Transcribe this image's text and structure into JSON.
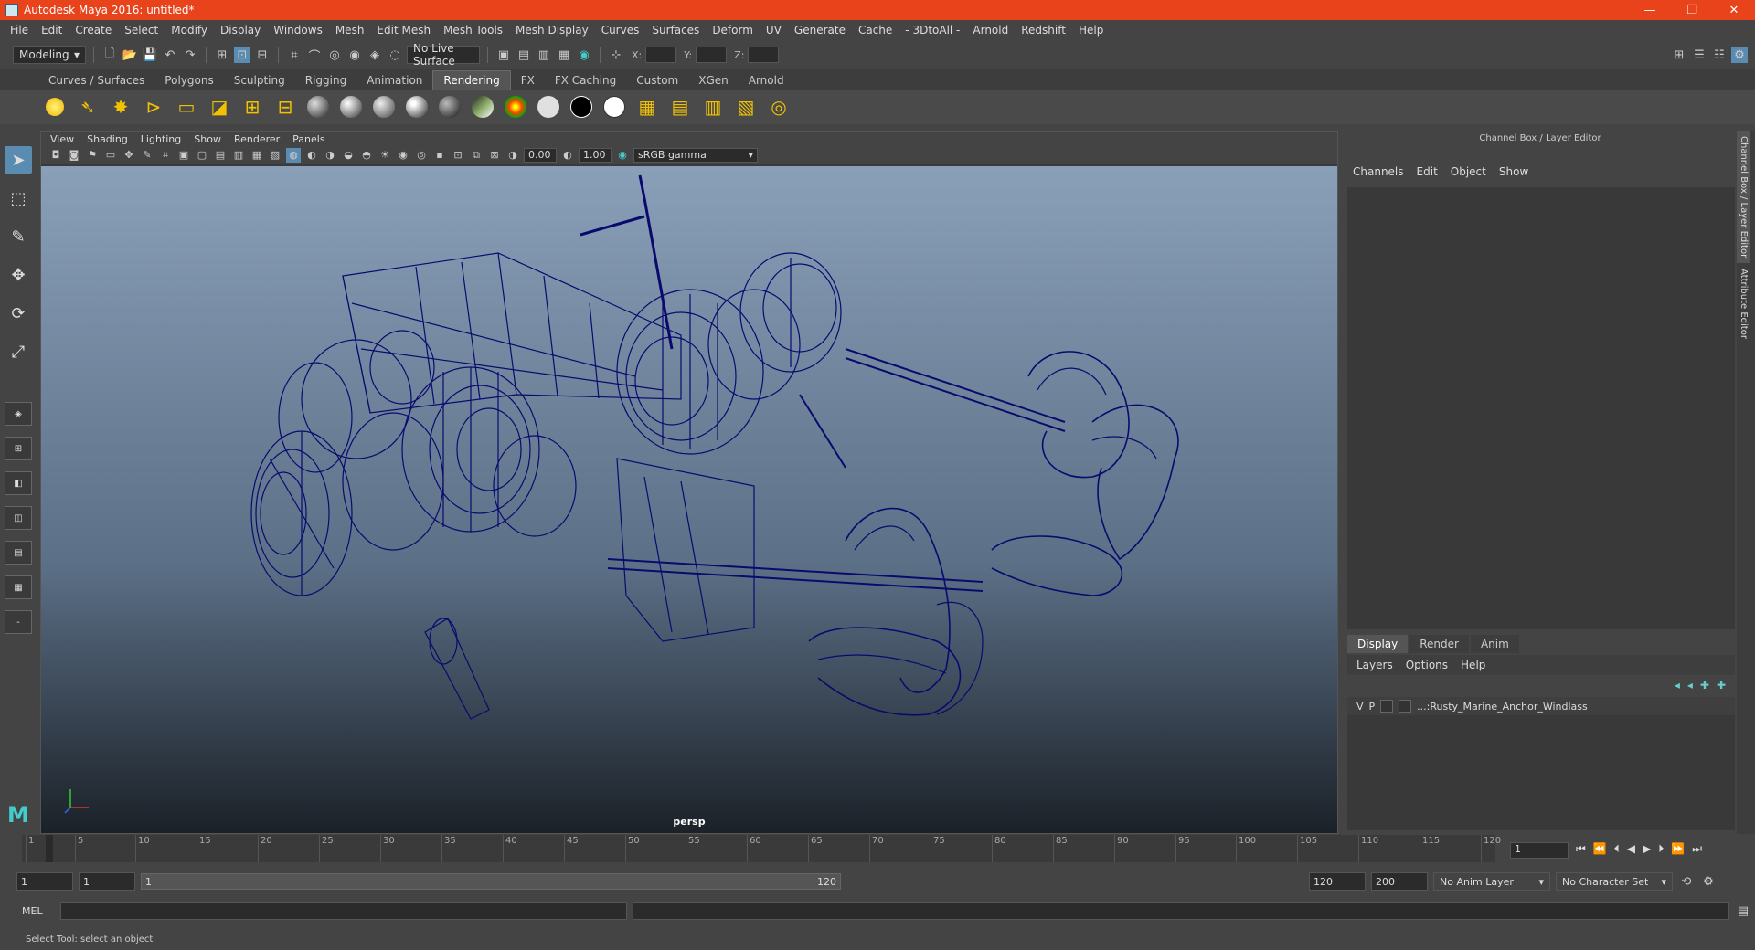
{
  "window": {
    "title": "Autodesk Maya 2016: untitled*",
    "controls": [
      "—",
      "❐",
      "✕"
    ]
  },
  "menubar": [
    "File",
    "Edit",
    "Create",
    "Select",
    "Modify",
    "Display",
    "Windows",
    "Mesh",
    "Edit Mesh",
    "Mesh Tools",
    "Mesh Display",
    "Curves",
    "Surfaces",
    "Deform",
    "UV",
    "Generate",
    "Cache",
    "- 3DtoAll -",
    "Arnold",
    "Redshift",
    "Help"
  ],
  "statusline": {
    "mode": "Modeling",
    "live_surface": "No Live Surface",
    "x_label": "X:",
    "y_label": "Y:",
    "z_label": "Z:"
  },
  "shelf": {
    "tabs": [
      "Curves / Surfaces",
      "Polygons",
      "Sculpting",
      "Rigging",
      "Animation",
      "Rendering",
      "FX",
      "FX Caching",
      "Custom",
      "XGen",
      "Arnold"
    ],
    "active_tab": "Rendering"
  },
  "viewport": {
    "menu": [
      "View",
      "Shading",
      "Lighting",
      "Show",
      "Renderer",
      "Panels"
    ],
    "exposure": "0.00",
    "gamma": "1.00",
    "color_space": "sRGB gamma",
    "camera": "persp"
  },
  "channelbox": {
    "title": "Channel Box / Layer Editor",
    "menu": [
      "Channels",
      "Edit",
      "Object",
      "Show"
    ],
    "side_tabs": [
      "Channel Box / Layer Editor",
      "Attribute Editor"
    ]
  },
  "layer_editor": {
    "tabs": [
      "Display",
      "Render",
      "Anim"
    ],
    "active_tab": "Display",
    "menu": [
      "Layers",
      "Options",
      "Help"
    ],
    "layers": [
      {
        "v": "V",
        "p": "P",
        "name": "...:Rusty_Marine_Anchor_Windlass"
      }
    ]
  },
  "timeline": {
    "ticks": [
      "1",
      "5",
      "10",
      "15",
      "20",
      "25",
      "30",
      "35",
      "40",
      "45",
      "50",
      "55",
      "60",
      "65",
      "70",
      "75",
      "80",
      "85",
      "90",
      "95",
      "100",
      "105",
      "110",
      "115",
      "120"
    ],
    "current_frame": "1"
  },
  "range": {
    "start": "1",
    "playback_start": "1",
    "slider_start": "1",
    "slider_end": "120",
    "playback_end": "120",
    "end": "200",
    "anim_layer": "No Anim Layer",
    "character_set": "No Character Set"
  },
  "command_line": {
    "label": "MEL"
  },
  "help_line": "Select Tool: select an object",
  "colors": {
    "titlebar": "#e8431a",
    "active_tool": "#5a8bb0",
    "wireframe": "#0a0a6e"
  }
}
